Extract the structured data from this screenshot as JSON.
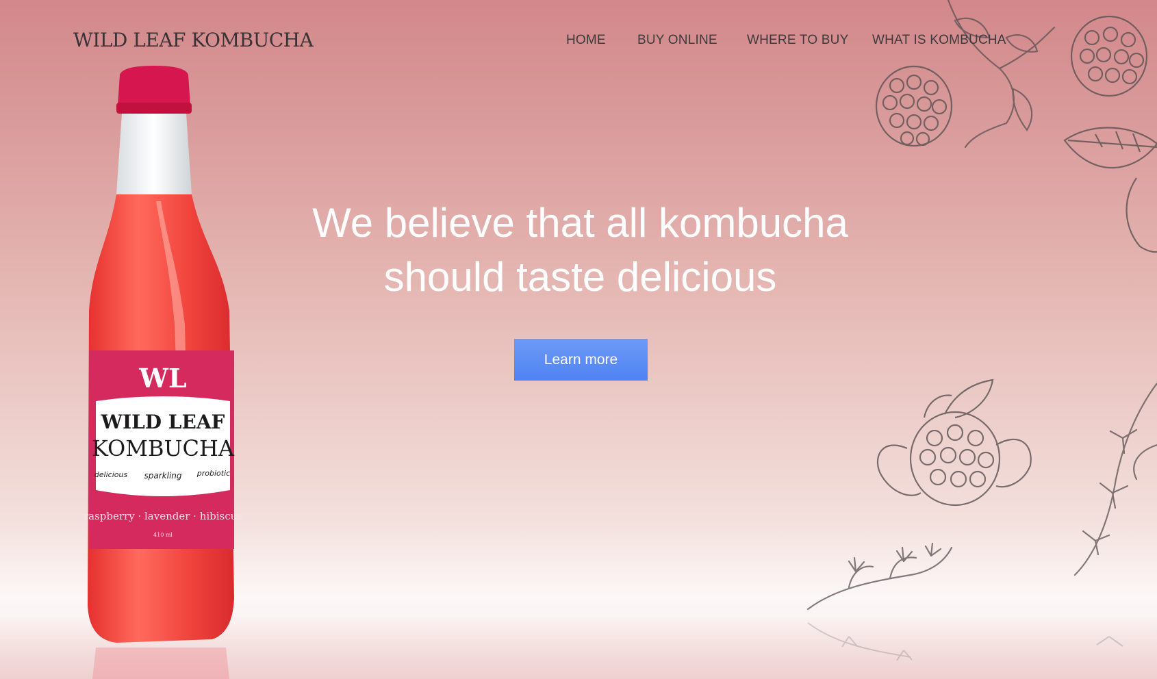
{
  "header": {
    "brand": "WILD LEAF KOMBUCHA",
    "nav": [
      "HOME",
      "BUY ONLINE",
      "WHERE TO BUY",
      "WHAT IS KOMBUCHA"
    ]
  },
  "hero": {
    "line1": "We believe that all kombucha",
    "line2": "should taste delicious",
    "cta_label": "Learn more"
  },
  "bottle_label": {
    "logo": "WL",
    "name_line1": "WILD LEAF",
    "name_line2": "KOMBUCHA",
    "tags": [
      "delicious",
      "sparkling",
      "probiotic"
    ],
    "flavor": "raspberry · lavender · hibiscus",
    "volume": "410 ml"
  },
  "colors": {
    "accent_button": "#5a8cf5",
    "background_top": "#d3888b",
    "background_bottom": "#fcf8f7",
    "bottle_label": "#d42a5e"
  }
}
